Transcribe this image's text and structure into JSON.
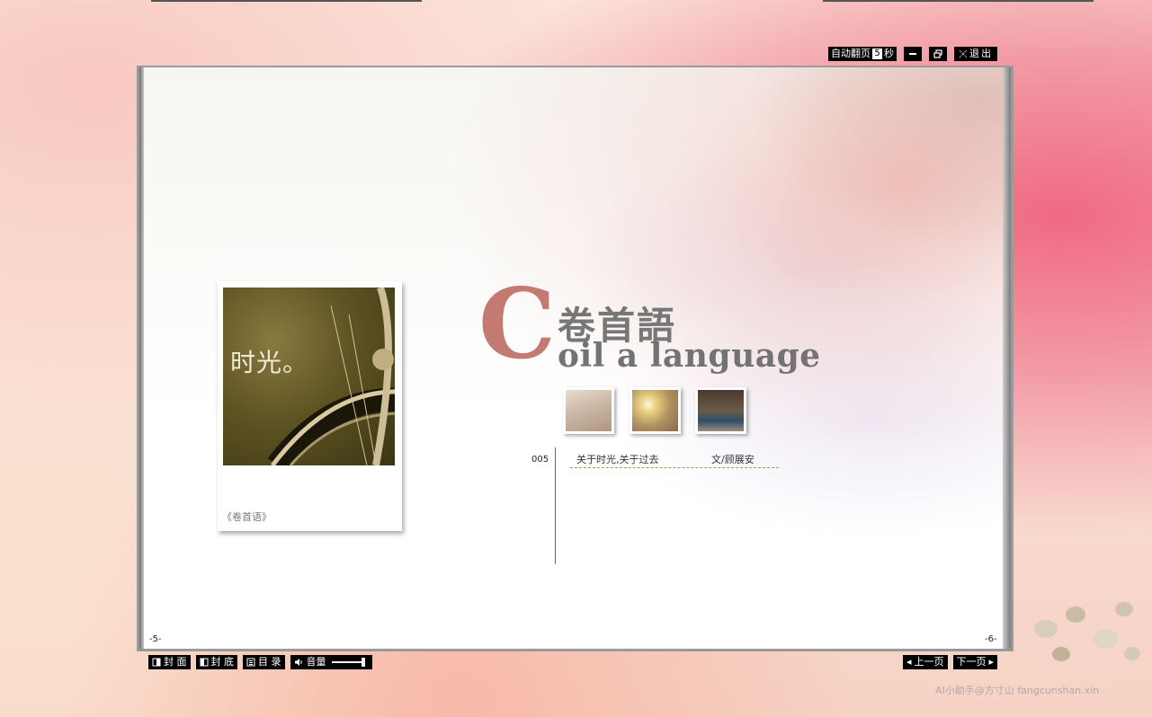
{
  "top_controls": {
    "auto_flip_label": "自动翻页",
    "seconds_value": "5",
    "seconds_unit": "秒",
    "exit_label": "退出"
  },
  "book": {
    "left_page_number": "-5-",
    "right_page_number": "-6-",
    "photo_text": "时光。",
    "photo_caption": "《卷首语》",
    "big_letter": "C",
    "heading_cn": "卷首語",
    "heading_en": "oil a language",
    "toc": {
      "number": "005",
      "title": "关于时光,关于过去",
      "author": "文/顾展安"
    }
  },
  "bottom_controls": {
    "cover_label": "封 面",
    "back_cover_label": "封 底",
    "contents_label": "目 录",
    "volume_label": "音量",
    "prev_label": "上一页",
    "next_label": "下一页"
  },
  "watermark": "AI小助手@方寸山  fangcunshan.xin",
  "colors": {
    "accent_c": "#c27a72",
    "control_bg": "#000000",
    "toc_rule": "#8aa65a"
  }
}
